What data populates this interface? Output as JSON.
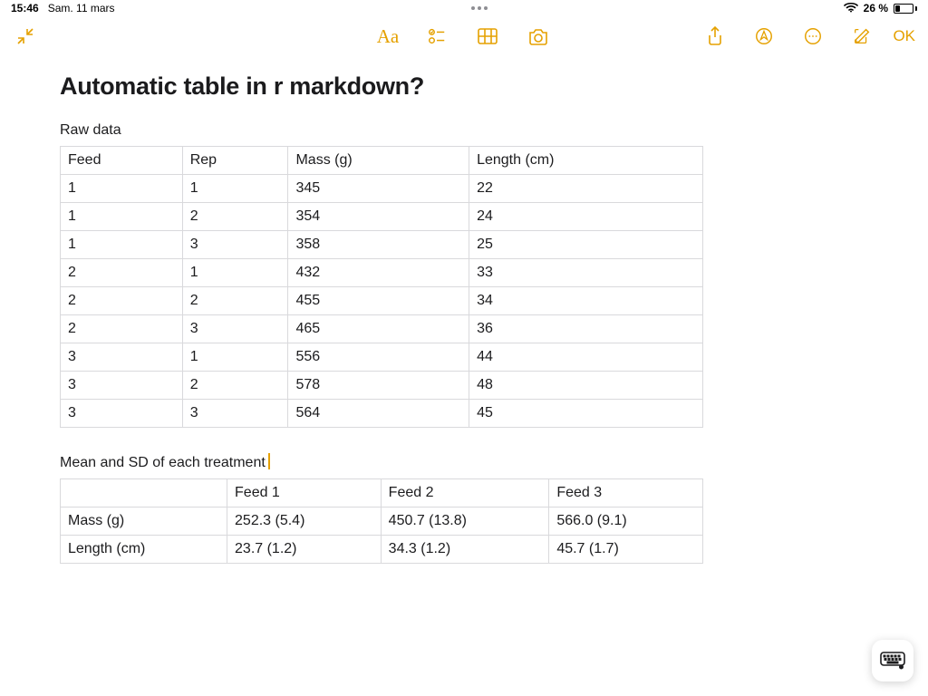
{
  "statusbar": {
    "time": "15:46",
    "date": "Sam. 11 mars",
    "battery_pct": "26 %",
    "battery_level": 26
  },
  "toolbar": {
    "ok_label": "OK"
  },
  "note": {
    "title": "Automatic table in r markdown?",
    "raw_label": "Raw data",
    "summary_label": "Mean and SD of each treatment",
    "raw_table": {
      "headers": [
        "Feed",
        "Rep",
        "Mass (g)",
        "Length (cm)"
      ],
      "rows": [
        [
          "1",
          "1",
          "345",
          "22"
        ],
        [
          "1",
          "2",
          "354",
          "24"
        ],
        [
          "1",
          "3",
          "358",
          "25"
        ],
        [
          "2",
          "1",
          "432",
          "33"
        ],
        [
          "2",
          "2",
          "455",
          "34"
        ],
        [
          "2",
          "3",
          "465",
          "36"
        ],
        [
          "3",
          "1",
          "556",
          "44"
        ],
        [
          "3",
          "2",
          "578",
          "48"
        ],
        [
          "3",
          "3",
          "564",
          "45"
        ]
      ]
    },
    "summary_table": {
      "headers": [
        "",
        "Feed 1",
        "Feed 2",
        "Feed 3"
      ],
      "rows": [
        [
          "Mass (g)",
          "252.3 (5.4)",
          "450.7 (13.8)",
          "566.0 (9.1)"
        ],
        [
          "Length (cm)",
          "23.7 (1.2)",
          "34.3 (1.2)",
          "45.7 (1.7)"
        ]
      ]
    }
  }
}
